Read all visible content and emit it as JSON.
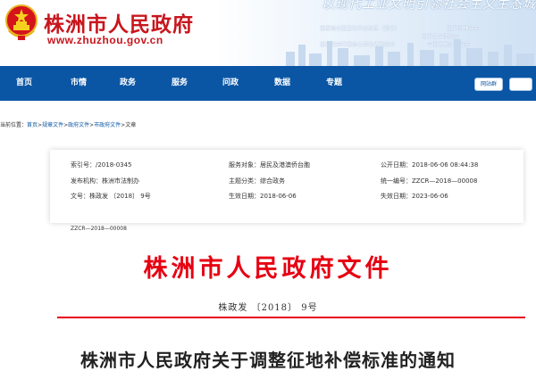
{
  "header": {
    "site_title": "株洲市人民政府",
    "site_url": "www.zhuzhou.gov.cn",
    "slogan": "以现代工业文明引领社会主义生态城",
    "honors": [
      "国家综合配套改革试验区（部分）",
      "国家园林城市",
      "国家级文明城市",
      "国家城市环境综合整治优秀城市",
      "中国优秀旅游城市"
    ]
  },
  "nav": {
    "items": [
      "首页",
      "市情",
      "政务",
      "服务",
      "问政",
      "数据",
      "专题"
    ],
    "buttons": [
      "网站群",
      ""
    ]
  },
  "breadcrumb": {
    "label": "当前位置：",
    "items": [
      "首页",
      "规章文件",
      "政府文件",
      "市政府文件",
      "文章"
    ]
  },
  "meta": {
    "index_no": "索引号：/2018-0345",
    "service_target": "服务对象：居民及港澳侨台胞",
    "publish_date": "公开日期：2018-06-06 08:44:38",
    "issuer": "发布机构：株洲市法制办",
    "subject": "主题分类：综合政务",
    "unified_no": "统一编号：ZZCR—2018—00008",
    "doc_no": "文号：株政发 〔2018〕 9号",
    "effective_date": "生效日期：2018-06-06",
    "expire_date": "失效日期：2023-06-06"
  },
  "document": {
    "code": "ZZCR—2018—00008",
    "header": "株洲市人民政府文件",
    "number": "株政发 〔2018〕 9号",
    "title": "株洲市人民政府关于调整征地补偿标准的通知"
  },
  "colors": {
    "nav": "#0a56a4",
    "brand_red": "#c8161d",
    "doc_red": "#e60012"
  }
}
